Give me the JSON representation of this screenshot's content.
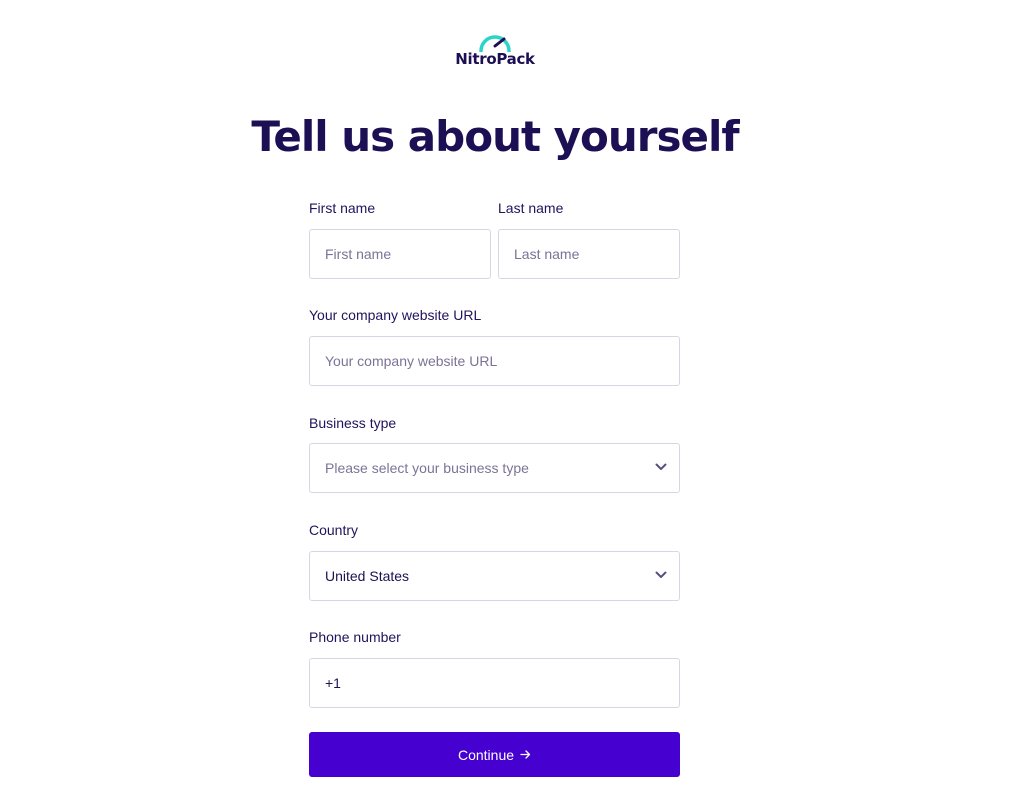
{
  "brand": {
    "name": "NitroPack",
    "accent": "#2ad4c9",
    "primary": "#4600cf"
  },
  "heading": "Tell us about yourself",
  "form": {
    "first_name": {
      "label": "First name",
      "placeholder": "First name",
      "value": ""
    },
    "last_name": {
      "label": "Last name",
      "placeholder": "Last name",
      "value": ""
    },
    "website": {
      "label": "Your company website URL",
      "placeholder": "Your company website URL",
      "value": ""
    },
    "business_type": {
      "label": "Business type",
      "placeholder": "Please select your business type",
      "icon": "chevron-down-icon"
    },
    "country": {
      "label": "Country",
      "value": "United States",
      "icon": "chevron-down-icon"
    },
    "phone": {
      "label": "Phone number",
      "value": "+1"
    },
    "submit": {
      "label": "Continue",
      "icon": "arrow-right-icon"
    }
  }
}
